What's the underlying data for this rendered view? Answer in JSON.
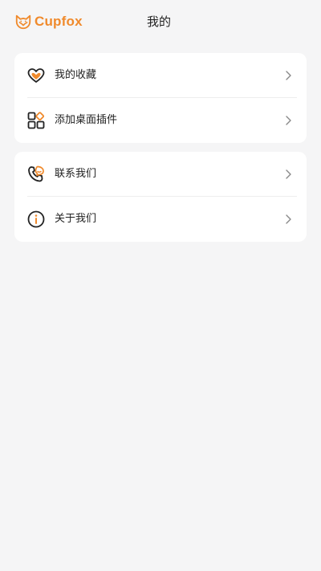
{
  "header": {
    "logo_text": "Cupfox",
    "title": "我的"
  },
  "colors": {
    "brand": "#f08a2c",
    "background": "#f5f5f6",
    "card": "#ffffff",
    "text": "#222222"
  },
  "groups": [
    {
      "items": [
        {
          "label": "我的收藏",
          "icon": "heart-icon"
        },
        {
          "label": "添加桌面插件",
          "icon": "widgets-grid-icon"
        }
      ]
    },
    {
      "items": [
        {
          "label": "联系我们",
          "icon": "phone-chat-icon"
        },
        {
          "label": "关于我们",
          "icon": "info-icon"
        }
      ]
    }
  ]
}
